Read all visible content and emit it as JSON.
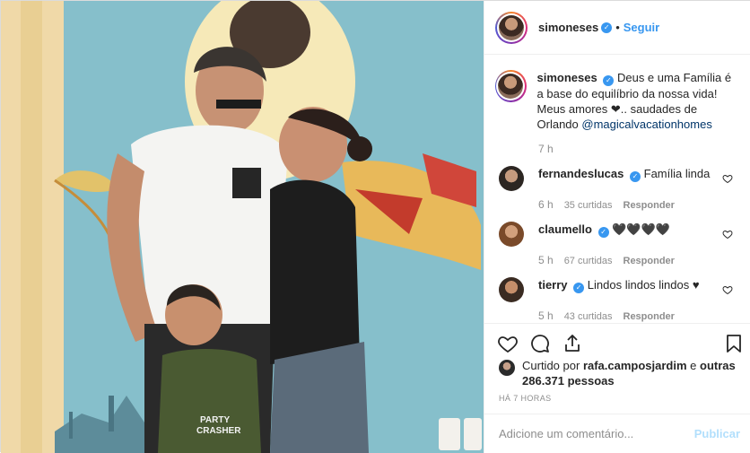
{
  "post": {
    "username": "simoneses",
    "verified_icon": "check-badge-icon",
    "follow_label": "Seguir",
    "separator": "•"
  },
  "caption": {
    "username": "simoneses",
    "text": "Deus e uma Família é a base do equilíbrio da nossa vida! Meus amores ❤.. saudades de Orlando",
    "mention": "@magicalvacationhomes",
    "time": "7 h"
  },
  "comments": [
    {
      "username": "fernandeslucas",
      "text": "Família linda",
      "time": "6 h",
      "likes": "35 curtidas",
      "reply": "Responder"
    },
    {
      "username": "claumello",
      "text": "🖤🖤🖤🖤",
      "time": "5 h",
      "likes": "67 curtidas",
      "reply": "Responder"
    },
    {
      "username": "tierry",
      "text": "Lindos lindos lindos ♥",
      "time": "5 h",
      "likes": "43 curtidas",
      "reply": "Responder"
    }
  ],
  "likes": {
    "prefix": "Curtido por",
    "user": "rafa.camposjardim",
    "conj": "e",
    "others": "outras 286.371 pessoas"
  },
  "posted_ago": "HÁ 7 HORAS",
  "add_comment": {
    "placeholder": "Adicione um comentário...",
    "publish_label": "Publicar"
  },
  "colors": {
    "accent": "#3897f0",
    "wall": "#7fb7c4",
    "text": "#262626",
    "muted": "#8e8e8e"
  }
}
